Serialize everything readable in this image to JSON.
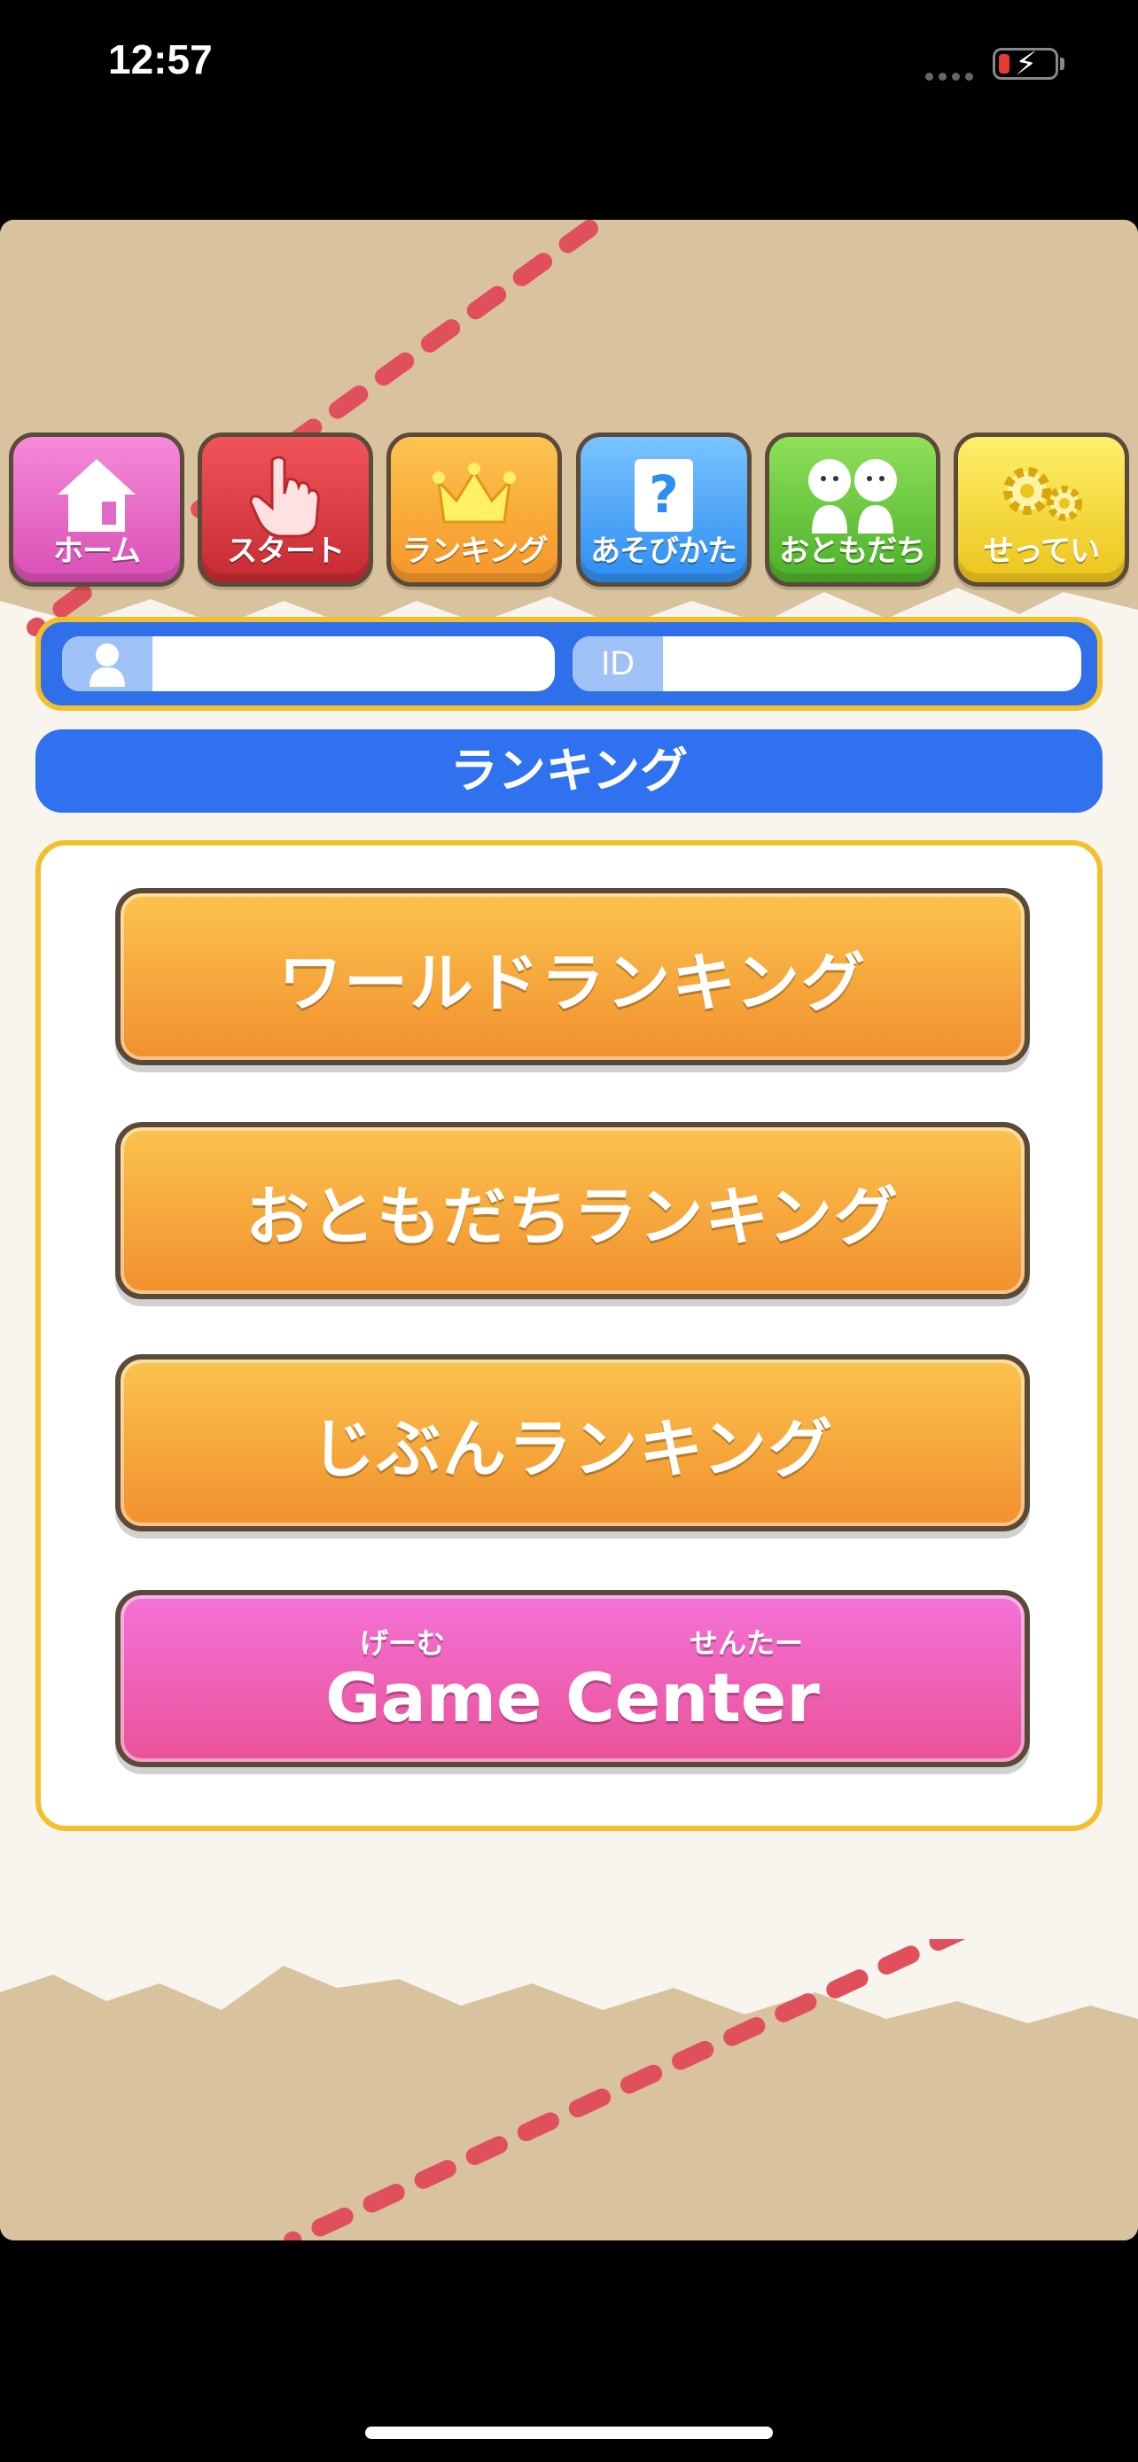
{
  "status": {
    "time": "12:57"
  },
  "nav": {
    "items": [
      {
        "label": "ホーム",
        "icon": "house-icon"
      },
      {
        "label": "スタート",
        "icon": "pointing-hand-icon"
      },
      {
        "label": "ランキング",
        "icon": "crown-icon"
      },
      {
        "label": "あそびかた",
        "icon": "question-icon"
      },
      {
        "label": "おともだち",
        "icon": "friends-icon"
      },
      {
        "label": "せってい",
        "icon": "gears-icon"
      }
    ]
  },
  "profile": {
    "name": "",
    "id_label": "ID",
    "id_value": ""
  },
  "section_title": "ランキング",
  "buttons": {
    "world": "ワールドランキング",
    "friends": "おともだちランキング",
    "self": "じぶんランキング",
    "game_center": {
      "ruby_left": "げーむ",
      "ruby_right": "せんたー",
      "label": "Game Center"
    }
  },
  "colors": {
    "accent_blue": "#2f71ee",
    "frame_yellow": "#f3c02b",
    "orange": "#f1902d",
    "pink": "#ea5297"
  }
}
